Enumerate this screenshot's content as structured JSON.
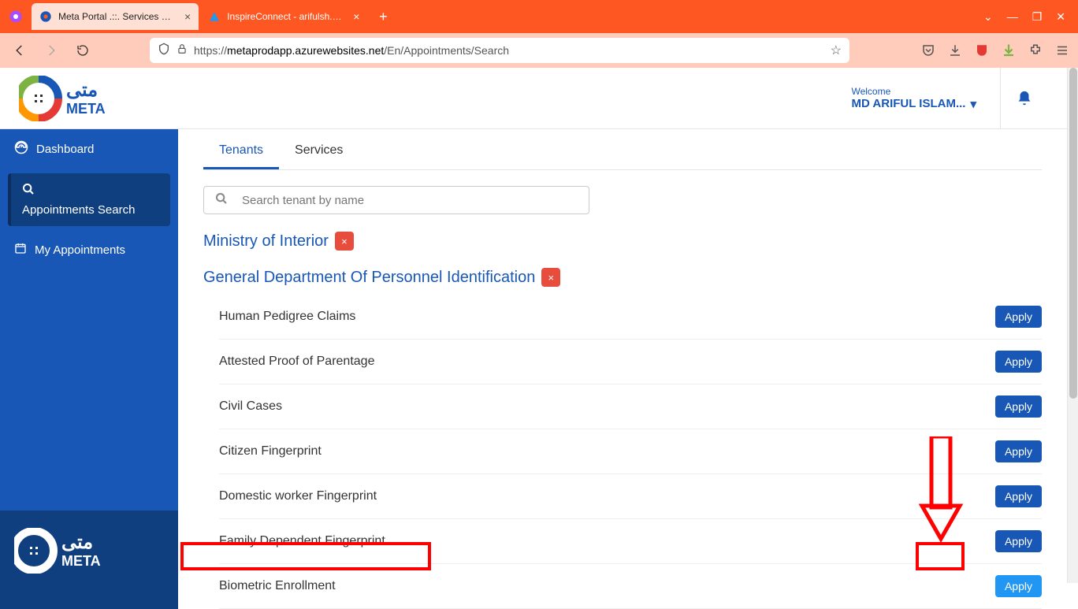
{
  "browser": {
    "tabs": [
      {
        "title": "Meta Portal .::. Services Search",
        "active": true
      },
      {
        "title": "InspireConnect - arifulsh.com",
        "active": false
      }
    ],
    "url_pre": "https://",
    "url_host": "metaprodapp.azurewebsites.net",
    "url_path": "/En/Appointments/Search"
  },
  "header": {
    "welcome": "Welcome",
    "user": "MD ARIFUL ISLAM..."
  },
  "sidebar": {
    "items": [
      {
        "label": "Dashboard",
        "icon": "gauge"
      },
      {
        "label": "Appointments Search",
        "icon": "search",
        "active": true
      },
      {
        "label": "My Appointments",
        "icon": "calendar"
      }
    ]
  },
  "main": {
    "tabs": [
      {
        "label": "Tenants",
        "active": true
      },
      {
        "label": "Services",
        "active": false
      }
    ],
    "search_placeholder": "Search tenant by name",
    "crumb1": "Ministry of Interior",
    "crumb2": "General Department Of Personnel Identification",
    "apply_label": "Apply",
    "services": [
      "Human Pedigree Claims",
      "Attested Proof of Parentage",
      "Civil Cases",
      "Citizen Fingerprint",
      "Domestic worker Fingerprint",
      "Family Dependent Fingerprint",
      "Biometric Enrollment"
    ],
    "highlight_index": 6
  }
}
